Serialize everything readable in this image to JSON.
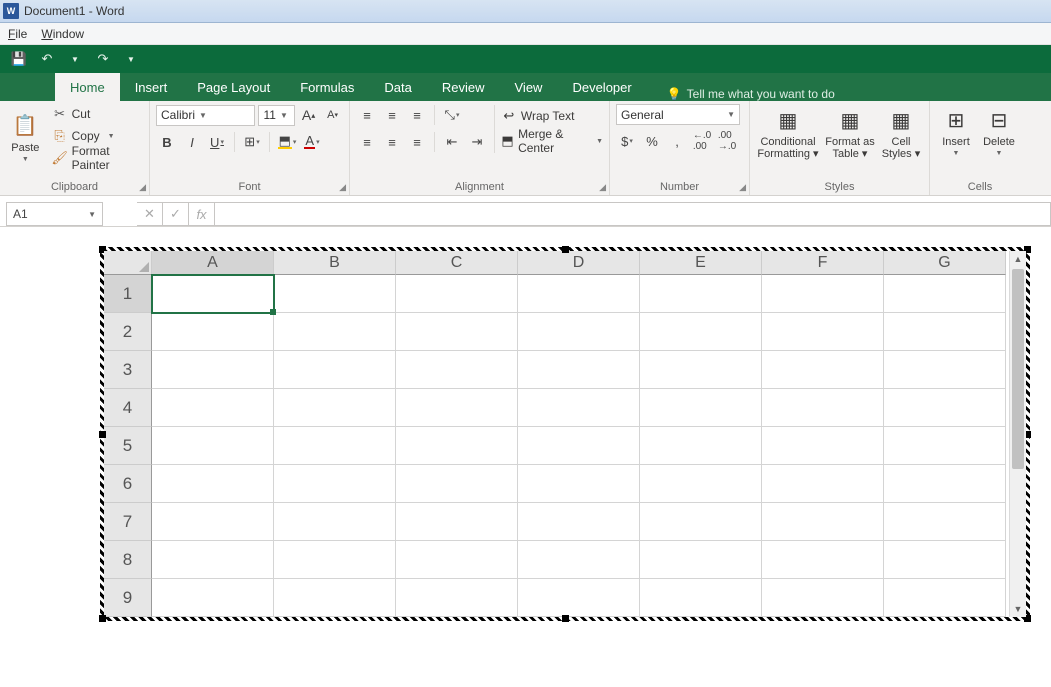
{
  "titlebar": {
    "app_badge": "W",
    "title": "Document1 - Word"
  },
  "word_menu": {
    "file": "File",
    "window": "Window"
  },
  "ribbon_tabs": {
    "home": "Home",
    "insert": "Insert",
    "page_layout": "Page Layout",
    "formulas": "Formulas",
    "data": "Data",
    "review": "Review",
    "view": "View",
    "developer": "Developer",
    "tellme": "Tell me what you want to do"
  },
  "clipboard": {
    "paste": "Paste",
    "cut": "Cut",
    "copy": "Copy",
    "format_painter": "Format Painter",
    "group": "Clipboard"
  },
  "font": {
    "name": "Calibri",
    "size": "11",
    "bold": "B",
    "italic": "I",
    "underline": "U",
    "group": "Font",
    "grow": "A",
    "shrink": "A"
  },
  "alignment": {
    "wrap": "Wrap Text",
    "merge": "Merge & Center",
    "group": "Alignment"
  },
  "number": {
    "format": "General",
    "currency": "$",
    "percent": "%",
    "comma": ",",
    "inc_dec": ".00",
    "group": "Number"
  },
  "styles": {
    "conditional": "Conditional Formatting",
    "format_as": "Format as Table",
    "cell_styles": "Cell Styles",
    "group": "Styles"
  },
  "cells": {
    "insert": "Insert",
    "delete": "Delete",
    "group": "Cells"
  },
  "formula_bar": {
    "name_box": "A1",
    "cancel": "✕",
    "enter": "✓",
    "fx": "fx",
    "value": ""
  },
  "grid": {
    "columns": [
      "A",
      "B",
      "C",
      "D",
      "E",
      "F",
      "G"
    ],
    "rows": [
      "1",
      "2",
      "3",
      "4",
      "5",
      "6",
      "7",
      "8",
      "9"
    ],
    "selected_cell": "A1"
  }
}
